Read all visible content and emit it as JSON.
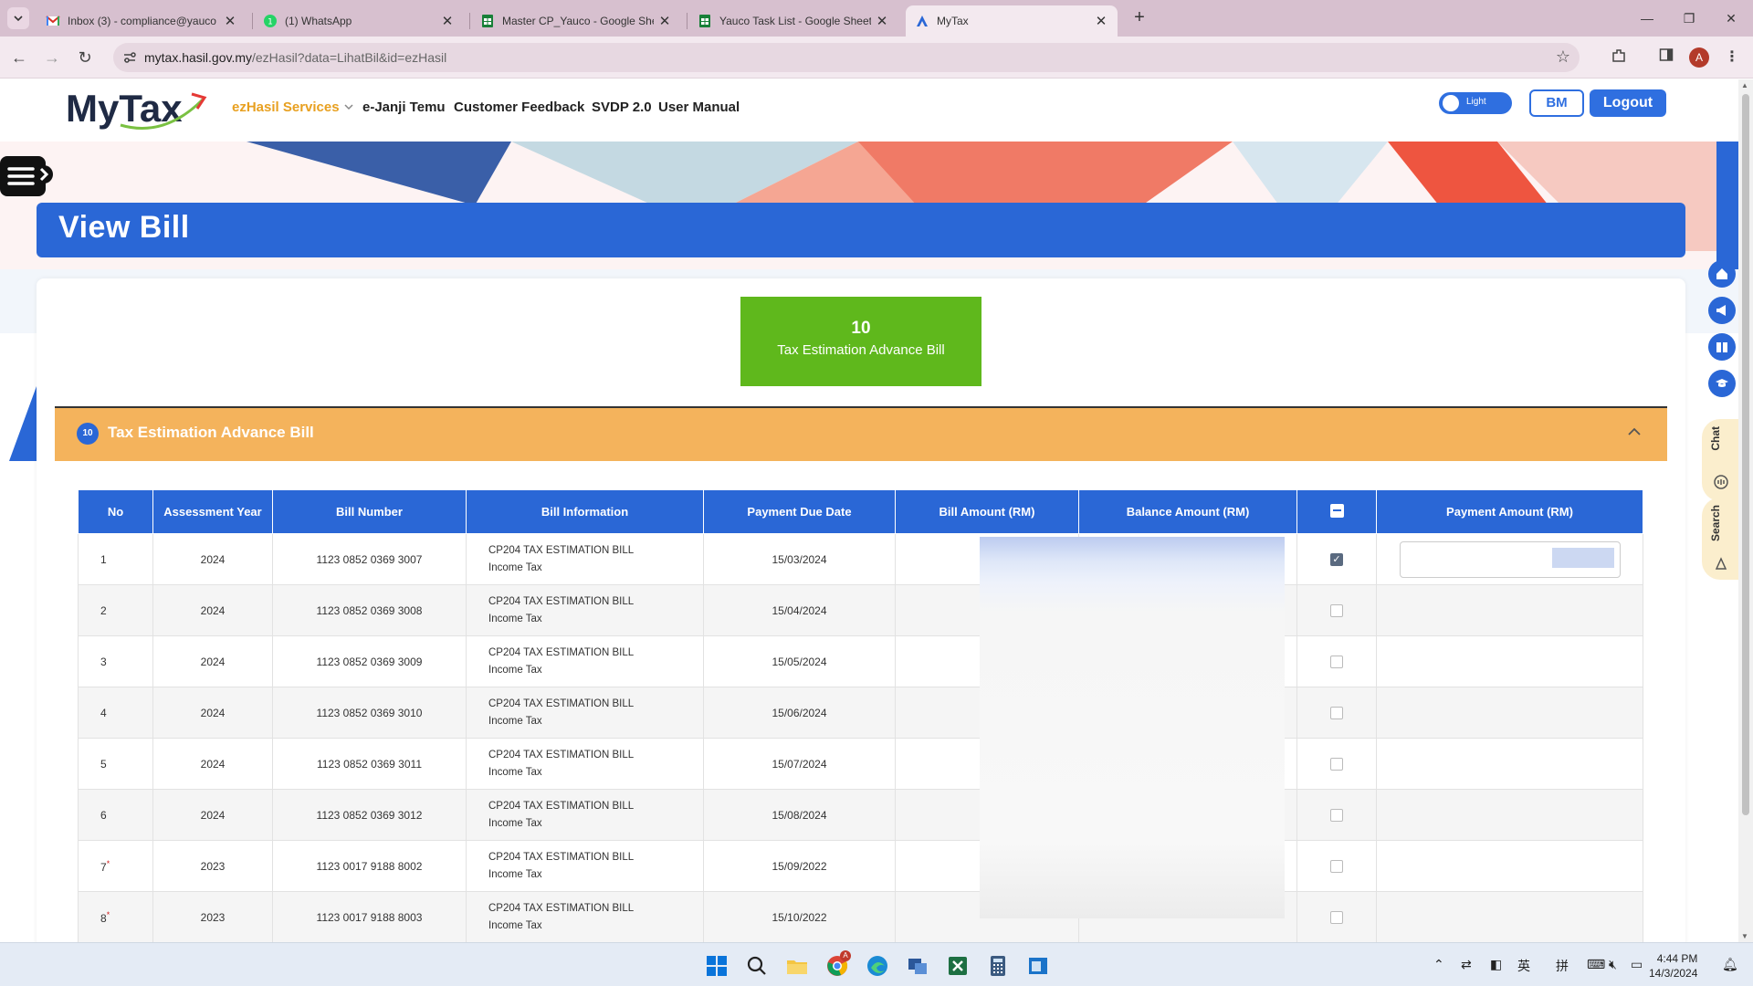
{
  "browser": {
    "tabs": [
      {
        "title": "Inbox (3) - compliance@yauco",
        "favicon": "gmail-icon"
      },
      {
        "title": "(1) WhatsApp",
        "favicon": "whatsapp-icon"
      },
      {
        "title": "Master CP_Yauco - Google Shee",
        "favicon": "sheets-icon"
      },
      {
        "title": "Yauco Task List - Google Sheets",
        "favicon": "sheets-icon"
      },
      {
        "title": "MyTax",
        "favicon": "mytax-icon"
      }
    ],
    "url_host": "mytax.hasil.gov.my",
    "url_path": "/ezHasil?data=LihatBil&id=ezHasil",
    "profile_initial": "A"
  },
  "header": {
    "logo_text": "MyTax",
    "nav": [
      "ezHasil Services",
      "e-Janji Temu",
      "Customer Feedback",
      "SVDP 2.0",
      "User Manual"
    ],
    "theme_toggle_label": "Light",
    "lang_button": "BM",
    "logout_button": "Logout"
  },
  "page": {
    "title": "View Bill",
    "summary": {
      "count": "10",
      "label": "Tax Estimation Advance Bill"
    },
    "section": {
      "badge": "10",
      "title": "Tax Estimation Advance Bill"
    }
  },
  "table": {
    "headers": [
      "No",
      "Assessment Year",
      "Bill Number",
      "Bill Information",
      "Payment Due Date",
      "Bill Amount (RM)",
      "Balance Amount (RM)",
      "",
      "Payment Amount (RM)"
    ],
    "rows": [
      {
        "no": "1",
        "star": false,
        "year": "2024",
        "bill_number": "1123 0852 0369 3007",
        "info_line1": "CP204 TAX ESTIMATION BILL",
        "info_line2": "Income Tax",
        "due": "15/03/2024",
        "checked": true
      },
      {
        "no": "2",
        "star": false,
        "year": "2024",
        "bill_number": "1123 0852 0369 3008",
        "info_line1": "CP204 TAX ESTIMATION BILL",
        "info_line2": "Income Tax",
        "due": "15/04/2024",
        "checked": false
      },
      {
        "no": "3",
        "star": false,
        "year": "2024",
        "bill_number": "1123 0852 0369 3009",
        "info_line1": "CP204 TAX ESTIMATION BILL",
        "info_line2": "Income Tax",
        "due": "15/05/2024",
        "checked": false
      },
      {
        "no": "4",
        "star": false,
        "year": "2024",
        "bill_number": "1123 0852 0369 3010",
        "info_line1": "CP204 TAX ESTIMATION BILL",
        "info_line2": "Income Tax",
        "due": "15/06/2024",
        "checked": false
      },
      {
        "no": "5",
        "star": false,
        "year": "2024",
        "bill_number": "1123 0852 0369 3011",
        "info_line1": "CP204 TAX ESTIMATION BILL",
        "info_line2": "Income Tax",
        "due": "15/07/2024",
        "checked": false
      },
      {
        "no": "6",
        "star": false,
        "year": "2024",
        "bill_number": "1123 0852 0369 3012",
        "info_line1": "CP204 TAX ESTIMATION BILL",
        "info_line2": "Income Tax",
        "due": "15/08/2024",
        "checked": false
      },
      {
        "no": "7",
        "star": true,
        "year": "2023",
        "bill_number": "1123 0017 9188 8002",
        "info_line1": "CP204 TAX ESTIMATION BILL",
        "info_line2": "Income Tax",
        "due": "15/09/2022",
        "checked": false
      },
      {
        "no": "8",
        "star": true,
        "year": "2023",
        "bill_number": "1123 0017 9188 8003",
        "info_line1": "CP204 TAX ESTIMATION BILL",
        "info_line2": "Income Tax",
        "due": "15/10/2022",
        "checked": false
      }
    ]
  },
  "side_widgets": {
    "chat": "Chat",
    "search": "Search"
  },
  "taskbar": {
    "time": "4:44 PM",
    "date": "14/3/2024",
    "tray_lang1": "英",
    "tray_lang2": "拼",
    "chrome_badge": "A"
  },
  "colors": {
    "primary_blue": "#2a67d6",
    "summary_green": "#5fb81c",
    "section_orange": "#f4b35c",
    "nav_highlight": "#e8a020"
  }
}
